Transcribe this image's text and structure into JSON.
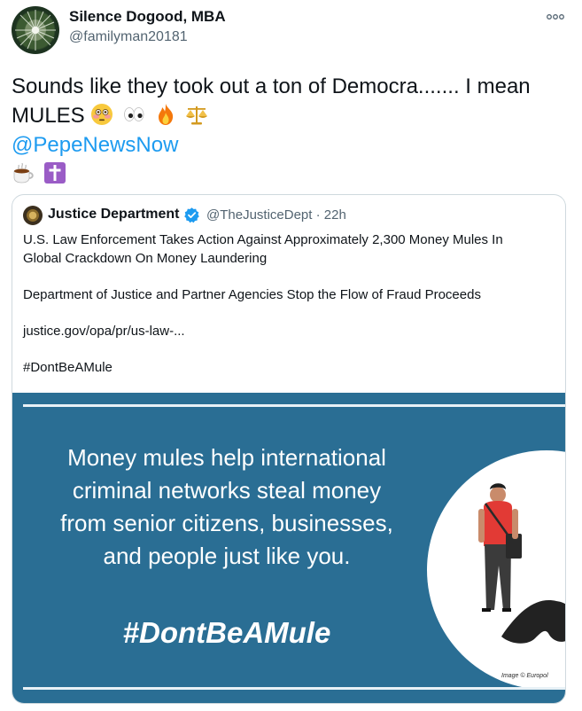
{
  "author": {
    "name": "Silence Dogood, MBA",
    "handle": "@familyman20181"
  },
  "tweet": {
    "line1": "Sounds like they took out a ton of Democra....... I mean",
    "line2": "MULES",
    "emojis": [
      "flushed-face-icon",
      "eyes-icon",
      "fire-icon",
      "balance-scale-icon"
    ],
    "mention": "@PepeNewsNow",
    "emojis_line4": [
      "hot-beverage-icon",
      "latin-cross-icon"
    ]
  },
  "quote": {
    "name": "Justice Department",
    "handle": "@TheJusticeDept",
    "separator": "·",
    "time": "22h",
    "headline_1": "U.S. Law Enforcement Takes Action Against Approximately 2,300 Money Mules In",
    "headline_2": "Global Crackdown On Money Laundering",
    "subhead": "Department of Justice and Partner Agencies Stop the Flow of Fraud Proceeds",
    "link": "justice.gov/opa/pr/us-law-...",
    "hashtag": "#DontBeAMule"
  },
  "media": {
    "message_lines": [
      "Money mules help international",
      "criminal networks steal money",
      "from senior citizens, businesses,",
      "and people just like you."
    ],
    "tag": "#DontBeAMule",
    "credit": "Image © Europol",
    "colors": {
      "background": "#2a6e94",
      "rule": "#e8f1f6"
    }
  },
  "colors": {
    "mention": "#1d9bf0",
    "muted": "#536471",
    "verified": "#1d9bf0"
  }
}
